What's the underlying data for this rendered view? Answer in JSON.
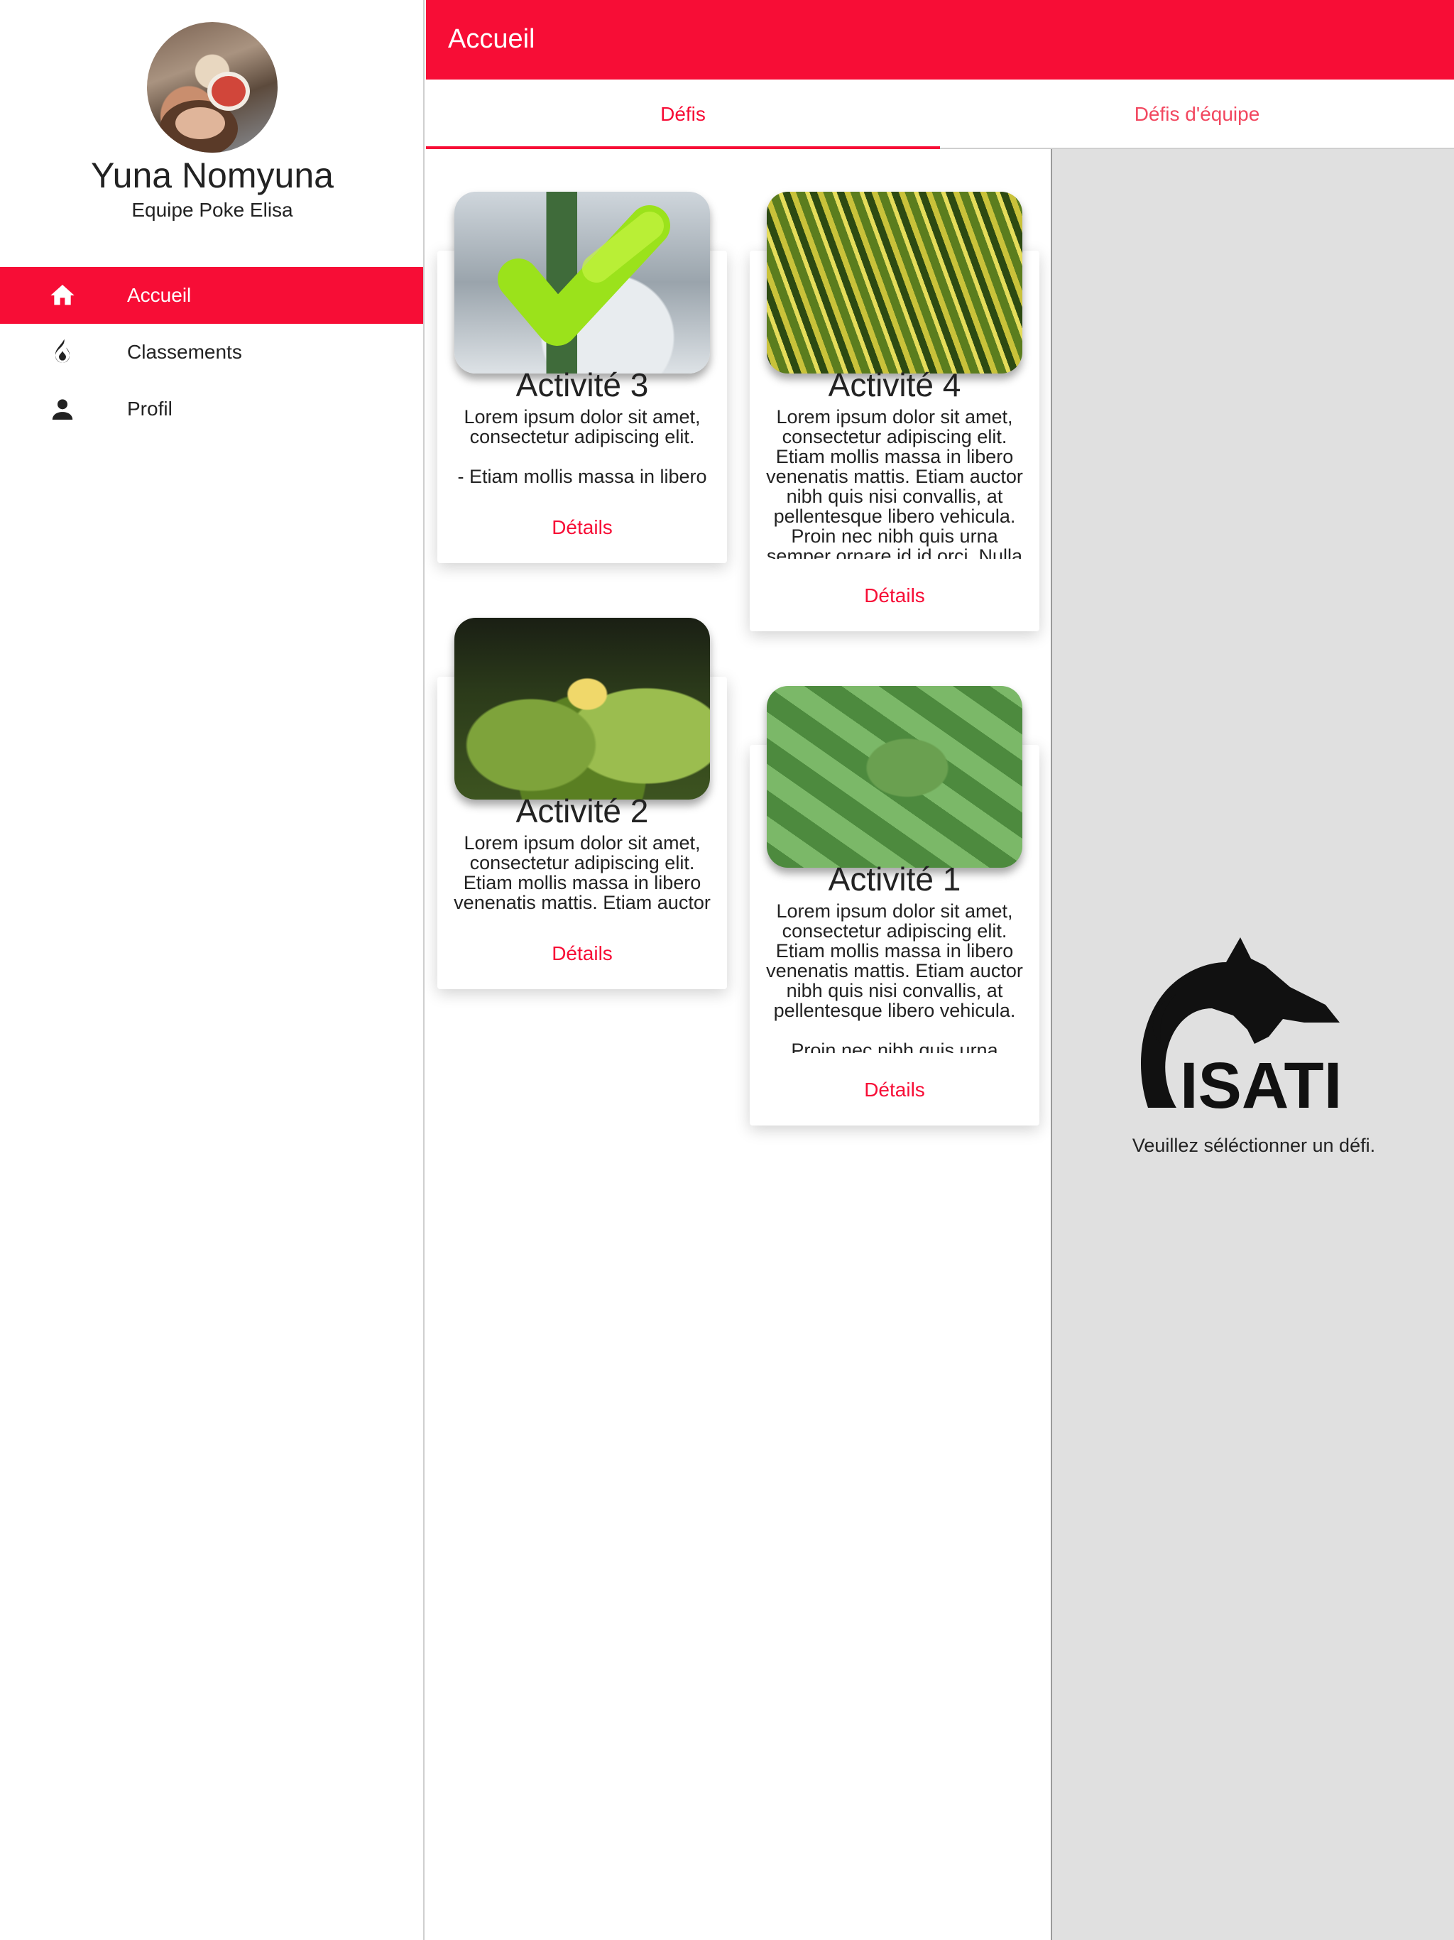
{
  "app": {
    "title": "Accueil"
  },
  "profile": {
    "name": "Yuna Nomyuna",
    "team": "Equipe Poke Elisa"
  },
  "nav": {
    "items": [
      {
        "label": "Accueil",
        "icon": "home-icon",
        "active": true
      },
      {
        "label": "Classements",
        "icon": "flame-icon",
        "active": false
      },
      {
        "label": "Profil",
        "icon": "person-icon",
        "active": false
      }
    ]
  },
  "tabs": [
    {
      "label": "Défis",
      "active": true
    },
    {
      "label": "Défis d'équipe",
      "active": false
    }
  ],
  "cards": [
    {
      "title": "Activité 3",
      "description": "Lorem ipsum dolor sit amet, consectetur adipiscing elit.\n\n-  Etiam mollis massa in libero venenatis mattis.",
      "action": "Détails",
      "image": "cactus",
      "completed": true
    },
    {
      "title": "Activité 4",
      "description": "Lorem ipsum dolor sit amet, consectetur adipiscing elit. Etiam mollis massa in libero venenatis mattis. Etiam auctor nibh quis nisi convallis, at pellentesque libero vehicula. Proin nec nibh quis urna semper ornare id id orci. Nulla",
      "action": "Détails",
      "image": "grass",
      "completed": false
    },
    {
      "title": "Activité 2",
      "description": "Lorem ipsum dolor sit amet, consectetur adipiscing elit. Etiam mollis massa in libero venenatis mattis. Etiam auctor nibh quis nisi convallis.",
      "action": "Détails",
      "image": "flower",
      "completed": false
    },
    {
      "title": "Activité 1",
      "description": "Lorem ipsum dolor sit amet, consectetur adipiscing elit. Etiam mollis massa in libero venenatis mattis. Etiam auctor nibh quis nisi convallis, at pellentesque libero vehicula.\n\nProin nec nibh quis urna",
      "action": "Détails",
      "image": "aloe",
      "completed": false
    }
  ],
  "detail": {
    "logo_text": "ISATI",
    "message": "Veuillez séléctionner un défi."
  },
  "colors": {
    "accent": "#f70d36",
    "tab_inactive": "#f2475f",
    "panel_bg": "#e0e0e0",
    "check": "#9be21b"
  }
}
